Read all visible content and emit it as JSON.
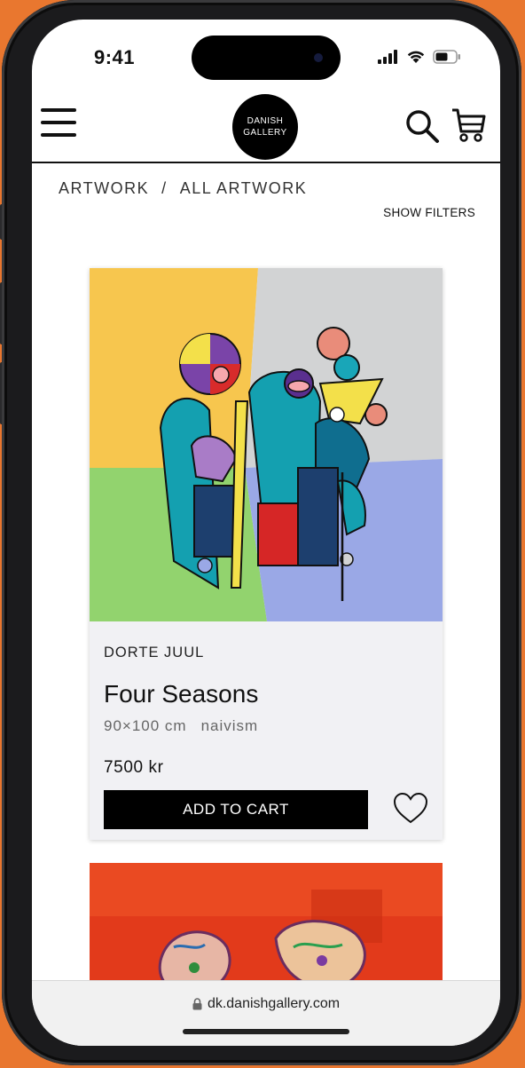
{
  "status_bar": {
    "time": "9:41"
  },
  "header": {
    "logo_line1": "DANISH",
    "logo_line2": "GALLERY"
  },
  "breadcrumb": {
    "root": "ARTWORK",
    "separator": "/",
    "current": "ALL ARTWORK"
  },
  "filters": {
    "label": "SHOW FILTERS"
  },
  "product": {
    "artist": "DORTE JUUL",
    "title": "Four Seasons",
    "size": "90×100 cm",
    "style": "naivism",
    "price": "7500 kr",
    "add_to_cart": "ADD TO CART"
  },
  "browser": {
    "url": "dk.danishgallery.com"
  },
  "colors": {
    "background": "#e9772f",
    "button": "#000000",
    "card": "#f1f1f4"
  }
}
